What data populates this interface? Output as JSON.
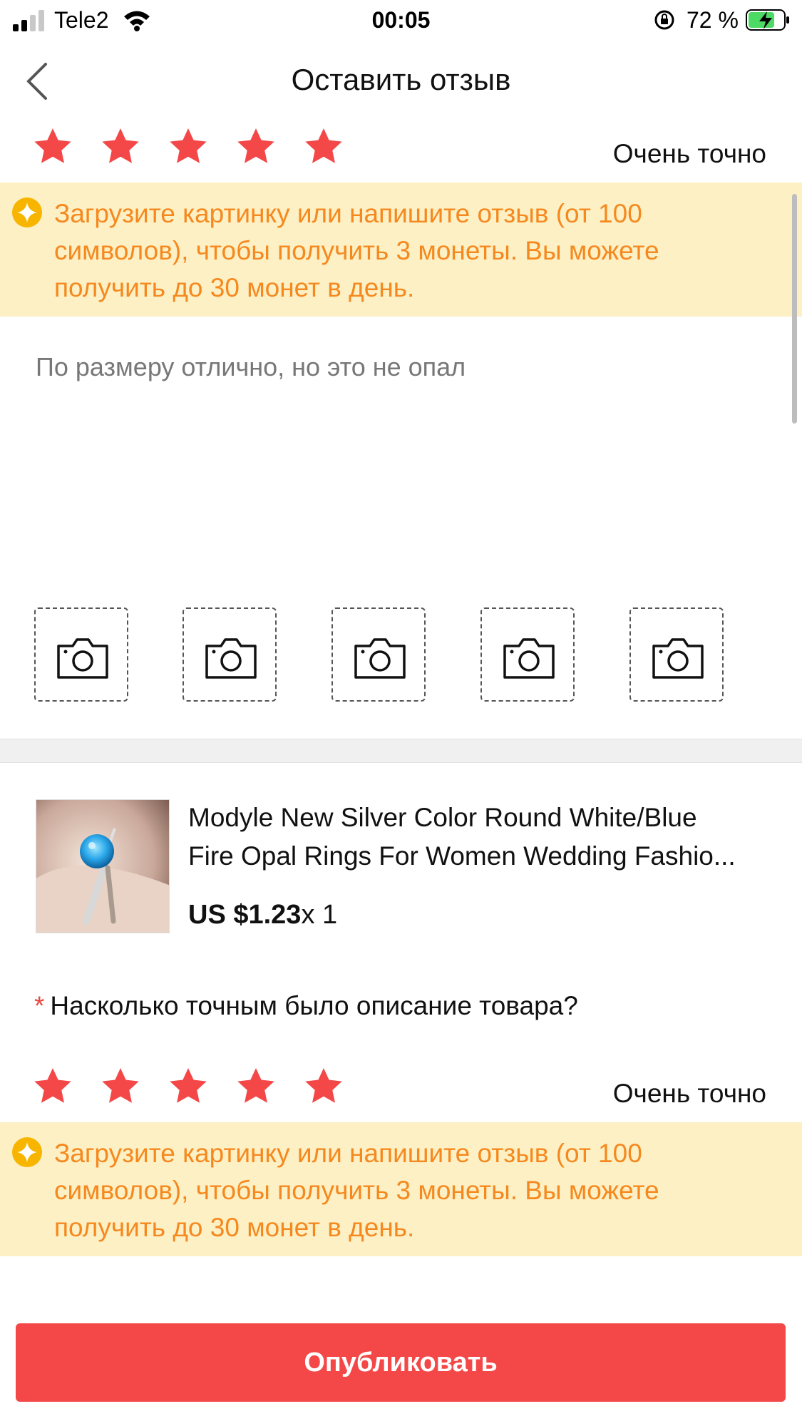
{
  "status_bar": {
    "carrier": "Tele2",
    "time": "00:05",
    "battery": "72 %"
  },
  "header": {
    "title": "Оставить отзыв",
    "back_icon": "chevron-left-icon"
  },
  "store_rating": {
    "stars": 5,
    "max_stars": 5,
    "label": "Очень точно"
  },
  "coin_banner": {
    "icon": "coin-sparkle-icon",
    "text": "Загрузите картинку или напишите отзыв (от 100 символов), чтобы получить 3 монеты. Вы можете получить до 30 монет в день.",
    "lines": [
      "Загрузите картинку или напишите отзыв (от 100",
      "символов), чтобы получить 3 монеты. Вы можете",
      "получить до 30 монет в день."
    ]
  },
  "review": {
    "value": "По размеру отлично, но это не опал"
  },
  "photo_slots": {
    "count": 5,
    "icon": "camera-icon"
  },
  "product": {
    "title_line1": "Modyle New Silver Color Round White/Blue",
    "title_line2": "Fire Opal Rings For Women Wedding Fashio...",
    "price": "US $1.23",
    "quantity": "x 1"
  },
  "description_question": {
    "required_mark": "*",
    "text": "Насколько точным было описание товара?"
  },
  "description_rating": {
    "stars": 5,
    "max_stars": 5,
    "label": "Очень точно"
  },
  "publish_button": {
    "label": "Опубликовать"
  },
  "colors": {
    "star": "#f44848",
    "banner_bg": "#fdf0c4",
    "banner_text": "#f5891f",
    "coin": "#f7b500",
    "publish_bg": "#f44848"
  }
}
